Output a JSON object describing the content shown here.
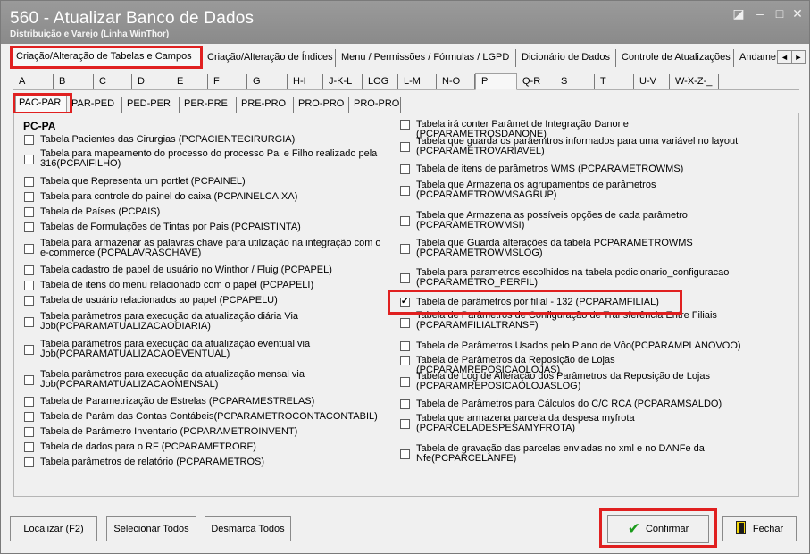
{
  "window": {
    "title": "560 - Atualizar Banco de Dados",
    "subtitle": "Distribuição e Varejo (Linha WinThor)",
    "controls": {
      "restore": "◪",
      "minimize": "–",
      "maximize": "□",
      "close": "✕"
    }
  },
  "top_tabs": [
    "Criação/Alteração de Tabelas e Campos",
    "Criação/Alteração de Índices",
    "Menu / Permissões / Fórmulas / LGPD",
    "Dicionário de Dados",
    "Controle de Atualizações",
    "Andame"
  ],
  "tab_scroll": {
    "left": "◄",
    "right": "►"
  },
  "letter_tabs": [
    "A",
    "B",
    "C",
    "D",
    "E",
    "F",
    "G",
    "H-I",
    "J-K-L",
    "LOG",
    "L-M",
    "N-O",
    "P",
    "Q-R",
    "S",
    "T",
    "U-V",
    "W-X-Z-_"
  ],
  "range_tabs": [
    "PAC-PAR",
    "PAR-PED",
    "PED-PER",
    "PER-PRE",
    "PRE-PRO",
    "PRO-PRO",
    "PRO-PRO"
  ],
  "section_heading": "PC-PA",
  "left_items": [
    {
      "text": "Tabela Pacientes das Cirurgias (PCPACIENTECIRURGIA)",
      "checked": false
    },
    {
      "text": "Tabela para mapeamento do processo do processo Pai e Filho realizado pela 316(PCPAIFILHO)",
      "checked": false
    },
    {
      "text": "Tabela que Representa um portlet (PCPAINEL)",
      "checked": false
    },
    {
      "text": "Tabela para controle do painel do caixa (PCPAINELCAIXA)",
      "checked": false
    },
    {
      "text": "Tabela de Países (PCPAIS)",
      "checked": false
    },
    {
      "text": "Tabelas de Formulações de Tintas por Pais (PCPAISTINTA)",
      "checked": false
    },
    {
      "text": "Tabela para armazenar as palavras chave para utilização na integração com o e-commerce (PCPALAVRASCHAVE)",
      "checked": false
    },
    {
      "text": "Tabela cadastro de papel de usuário no Winthor / Fluig (PCPAPEL)",
      "checked": false
    },
    {
      "text": "Tabela de itens do menu relacionado com o papel (PCPAPELI)",
      "checked": false
    },
    {
      "text": "Tabela de usuário relacionados ao papel (PCPAPELU)",
      "checked": false
    },
    {
      "text": "Tabela parâmetros para execução da atualização diária Via Job(PCPARAMATUALIZACAODIARIA)",
      "checked": false
    },
    {
      "text": "Tabela parâmetros para execução da atualização eventual via Job(PCPARAMATUALIZACAOEVENTUAL)",
      "checked": false
    },
    {
      "text": "Tabela parâmetros para execução da atualização mensal via Job(PCPARAMATUALIZACAOMENSAL)",
      "checked": false
    },
    {
      "text": "Tabela de Parametrização de Estrelas (PCPARAMESTRELAS)",
      "checked": false
    },
    {
      "text": "Tabela de Parâm das Contas Contábeis(PCPARAMETROCONTACONTABIL)",
      "checked": false
    },
    {
      "text": "Tabela de Parâmetro Inventario (PCPARAMETROINVENT)",
      "checked": false
    },
    {
      "text": "Tabela de dados para o RF (PCPARAMETRORF)",
      "checked": false
    },
    {
      "text": "Tabela parâmetros de relatório (PCPARAMETROS)",
      "checked": false
    }
  ],
  "right_items": [
    {
      "text": "Tabela irá conter Parâmet.de Integração Danone (PCPARAMETROSDANONE)",
      "checked": false
    },
    {
      "text": "Tabela que guarda os paräemtros informados para uma variável no layout (PCPARAMETROVARIAVEL)",
      "checked": false
    },
    {
      "text": "Tabela de itens de parâmetros WMS (PCPARAMETROWMS)",
      "checked": false
    },
    {
      "text": "Tabela que Armazena os agrupamentos de parâmetros (PCPARAMETROWMSAGRUP)",
      "checked": false
    },
    {
      "text": "Tabela que Armazena as possíveis opções de cada parâmetro (PCPARAMETROWMSI)",
      "checked": false
    },
    {
      "text": "Tabela que Guarda alterações da tabela PCPARAMETROWMS (PCPARAMETROWMSLOG)",
      "checked": false
    },
    {
      "text": "Tabela para parametros escolhidos na tabela pcdicionario_configuracao (PCPARAMETRO_PERFIL)",
      "checked": false
    },
    {
      "text": "Tabela de parâmetros por filial - 132 (PCPARAMFILIAL)",
      "checked": true
    },
    {
      "text": "Tabela de Parâmetros de Configuração de Transferência Entre Filiais (PCPARAMFILIALTRANSF)",
      "checked": false
    },
    {
      "text": "Tabela de Parâmetros Usados pelo Plano de Vôo(PCPARAMPLANOVOO)",
      "checked": false
    },
    {
      "text": "Tabela de Parâmetros da Reposição de Lojas (PCPARAMREPOSICAOLOJAS)",
      "checked": false
    },
    {
      "text": "Tabela de Log de Alteração dos Parâmetros da Reposição de Lojas (PCPARAMREPOSICAOLOJASLOG)",
      "checked": false
    },
    {
      "text": "Tabela de Parâmetros para Cálculos do C/C RCA (PCPARAMSALDO)",
      "checked": false
    },
    {
      "text": "Tabela que armazena parcela da despesa myfrota (PCPARCELADESPESAMYFROTA)",
      "checked": false
    },
    {
      "text": "Tabela de gravação das parcelas enviadas no xml e no DANFe da Nfe(PCPARCELANFE)",
      "checked": false
    }
  ],
  "buttons": {
    "locate": {
      "pre": "",
      "u": "L",
      "post": "ocalizar (F2)"
    },
    "select_all": {
      "pre": "Selecionar ",
      "u": "T",
      "post": "odos"
    },
    "deselect_all": {
      "pre": "",
      "u": "D",
      "post": "esmarca Todos"
    },
    "confirm": {
      "pre": "",
      "u": "C",
      "post": "onfirmar"
    },
    "close": {
      "pre": "",
      "u": "F",
      "post": "echar"
    }
  },
  "icons": {
    "confirm": "check-icon",
    "close": "door-exit-icon"
  },
  "colors": {
    "highlight": "#e02020",
    "titlebar": "#8f8f8f",
    "confirm_icon": "#1a9a1a"
  }
}
